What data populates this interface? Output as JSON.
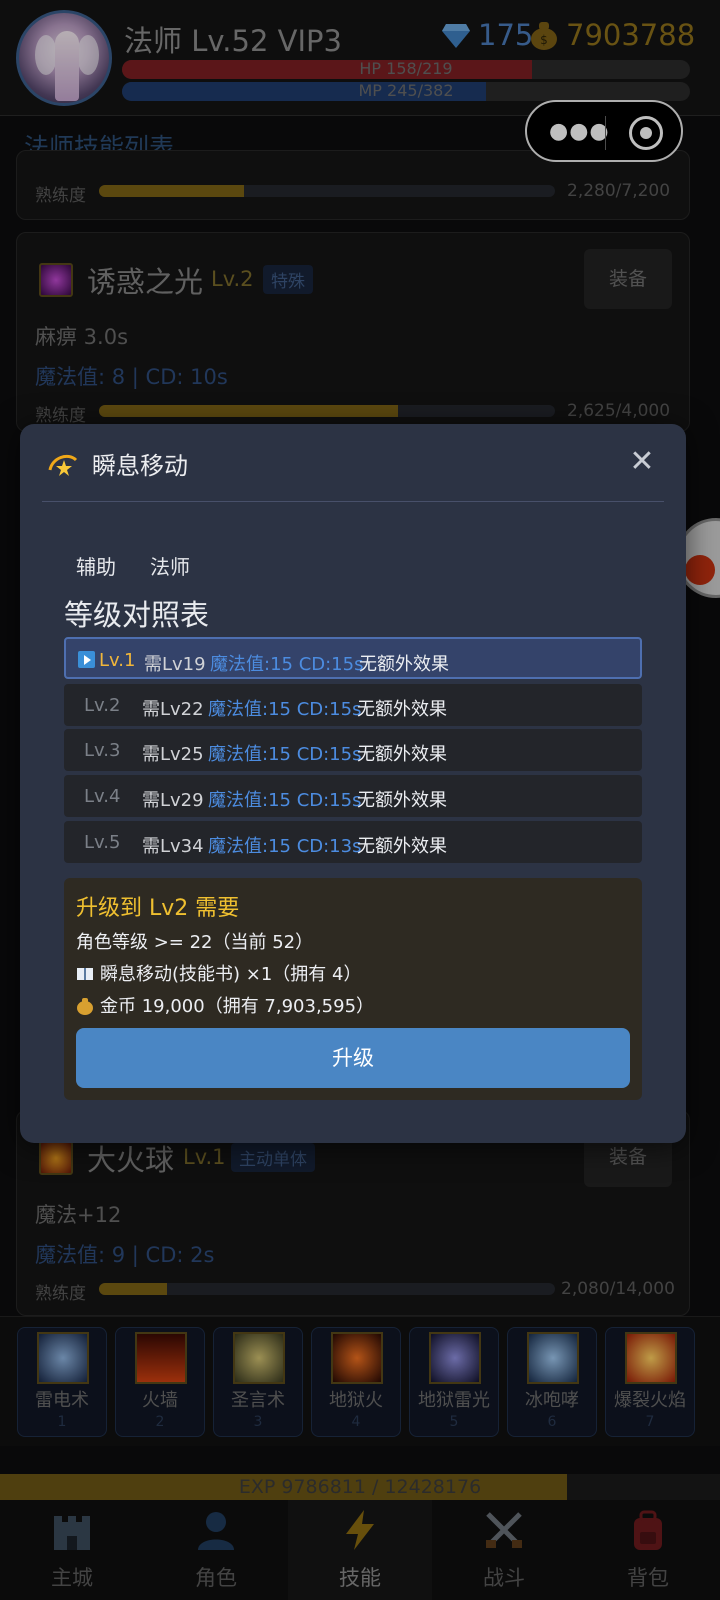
{
  "header": {
    "player": "法师 Lv.52  VIP3",
    "gems": "175",
    "gold": "7903788",
    "hp_label": "HP 158/219",
    "hp_fraction": 0.721,
    "mp_label": "MP 245/382",
    "mp_fraction": 0.641
  },
  "section_title": "法师技能列表",
  "cards": {
    "top": {
      "proficiency_label": "熟练度",
      "proficiency_value": "2,280/7,200",
      "proficiency_fraction": 0.317
    },
    "charm": {
      "name": "诱惑之光",
      "level": "Lv.2",
      "tag": "特殊",
      "equip": "装备",
      "effect": "麻痹 3.0s",
      "mp_cd": "魔法值: 8 | CD: 10s",
      "proficiency_label": "熟练度",
      "proficiency_value": "2,625/4,000",
      "proficiency_fraction": 0.656
    },
    "fireball": {
      "name": "大火球",
      "level": "Lv.1",
      "tag": "主动单体",
      "equip": "装备",
      "effect": "魔法+12",
      "mp_cd": "魔法值: 9 | CD: 2s",
      "proficiency_label": "熟练度",
      "proficiency_value": "2,080/14,000",
      "proficiency_fraction": 0.149
    }
  },
  "skill_bar": [
    {
      "name": "雷电术",
      "num": "1"
    },
    {
      "name": "火墙",
      "num": "2"
    },
    {
      "name": "圣言术",
      "num": "3"
    },
    {
      "name": "地狱火",
      "num": "4"
    },
    {
      "name": "地狱雷光",
      "num": "5"
    },
    {
      "name": "冰咆哮",
      "num": "6"
    },
    {
      "name": "爆裂火焰",
      "num": "7"
    }
  ],
  "exp": {
    "label": "EXP  9786811 / 12428176",
    "fraction": 0.787
  },
  "nav": [
    {
      "label": "主城",
      "icon": "castle-icon"
    },
    {
      "label": "角色",
      "icon": "person-icon"
    },
    {
      "label": "技能",
      "icon": "lightning-icon",
      "active": true
    },
    {
      "label": "战斗",
      "icon": "crossed-swords-icon"
    },
    {
      "label": "背包",
      "icon": "backpack-icon"
    }
  ],
  "modal": {
    "title": "瞬息移动",
    "close": "✕",
    "tags": [
      "辅助",
      "法师"
    ],
    "table_title": "等级对照表",
    "rows": [
      {
        "lv": "Lv.1",
        "req": "需Lv19",
        "mp": "魔法值:15 CD:15s",
        "effect": "无额外效果"
      },
      {
        "lv": "Lv.2",
        "req": "需Lv22",
        "mp": "魔法值:15 CD:15s",
        "effect": "无额外效果"
      },
      {
        "lv": "Lv.3",
        "req": "需Lv25",
        "mp": "魔法值:15 CD:15s",
        "effect": "无额外效果"
      },
      {
        "lv": "Lv.4",
        "req": "需Lv29",
        "mp": "魔法值:15 CD:15s",
        "effect": "无额外效果"
      },
      {
        "lv": "Lv.5",
        "req": "需Lv34",
        "mp": "魔法值:15 CD:13s",
        "effect": "无额外效果"
      }
    ],
    "upgrade": {
      "title": "升级到 Lv2 需要",
      "line1": "角色等级 >= 22（当前 52）",
      "line2": "瞬息移动(技能书) ×1（拥有 4）",
      "line3": "金币 19,000（拥有 7,903,595）",
      "button": "升级"
    }
  }
}
